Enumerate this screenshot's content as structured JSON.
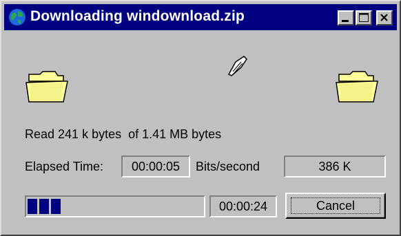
{
  "window": {
    "title": "Downloading windownload.zip",
    "icons": {
      "app": "globe-icon",
      "minimize": "minimize-icon",
      "maximize": "maximize-icon",
      "close": "close-icon"
    }
  },
  "animation": {
    "source": "folder-icon",
    "flying": "flying-document-icon",
    "destination": "folder-icon"
  },
  "status": {
    "read_text": "Read 241 k bytes  of 1.41 MB bytes"
  },
  "stats": {
    "elapsed_label": "Elapsed Time:",
    "elapsed_value": "00:00:05",
    "rate_label": "Bits/second",
    "rate_value": "386 K"
  },
  "progress": {
    "fraction": 0.2,
    "remaining": "00:00:24"
  },
  "buttons": {
    "cancel_label": "Cancel"
  },
  "colors": {
    "titlebar": "#000080",
    "face": "#c0c0c0",
    "progress_fill": "#000080",
    "folder": "#ffff99"
  }
}
